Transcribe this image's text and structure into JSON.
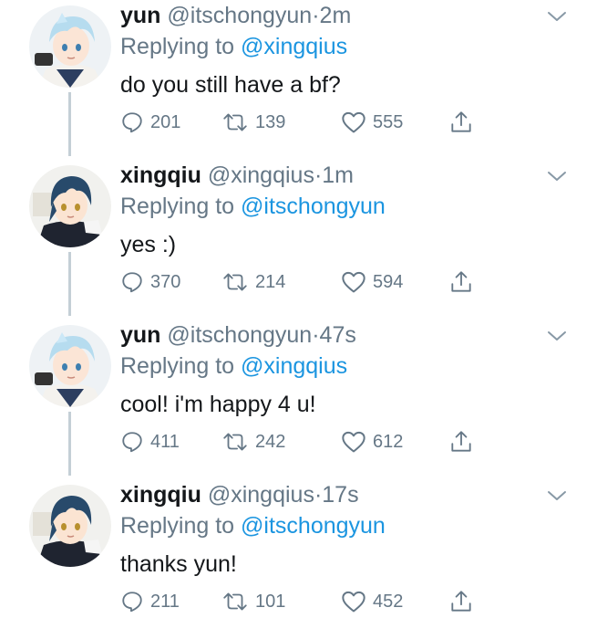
{
  "colors": {
    "name": "#14171a",
    "muted": "#657786",
    "link": "#1b95e0",
    "thread_line": "#c4cfd6"
  },
  "tweets": [
    {
      "name": "yun",
      "handle": "@itschongyun",
      "separator": "·",
      "time": "2m",
      "replying_prefix": "Replying to",
      "replying_to": "@xingqius",
      "text": "do you still have a bf?",
      "replies": "201",
      "retweets": "139",
      "likes": "555",
      "avatar": "chongyun-avatar"
    },
    {
      "name": "xingqiu",
      "handle": "@xingqius",
      "separator": "·",
      "time": "1m",
      "replying_prefix": "Replying to",
      "replying_to": "@itschongyun",
      "text": "yes :)",
      "replies": "370",
      "retweets": "214",
      "likes": "594",
      "avatar": "xingqiu-avatar"
    },
    {
      "name": "yun",
      "handle": "@itschongyun",
      "separator": "·",
      "time": "47s",
      "replying_prefix": "Replying to",
      "replying_to": "@xingqius",
      "text": "cool! i'm happy 4 u!",
      "replies": "411",
      "retweets": "242",
      "likes": "612",
      "avatar": "chongyun-avatar"
    },
    {
      "name": "xingqiu",
      "handle": "@xingqius",
      "separator": "·",
      "time": "17s",
      "replying_prefix": "Replying to",
      "replying_to": "@itschongyun",
      "text": "thanks yun!",
      "replies": "211",
      "retweets": "101",
      "likes": "452",
      "avatar": "xingqiu-avatar"
    }
  ]
}
